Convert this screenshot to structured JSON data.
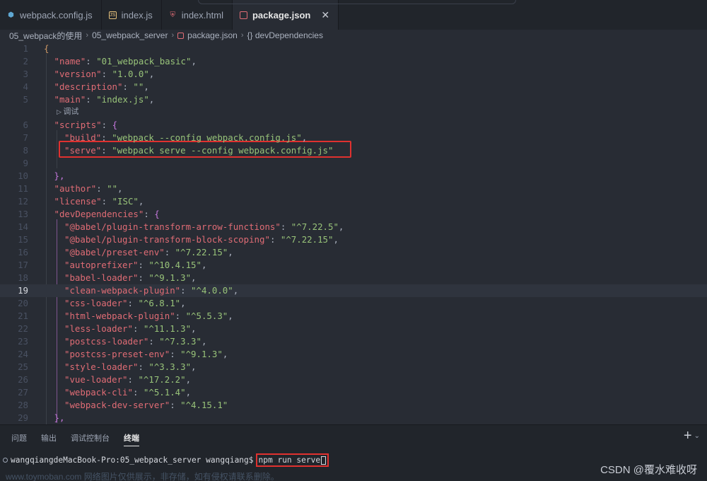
{
  "tabs": [
    {
      "label": "webpack.config.js",
      "icon": "webpack-icon",
      "color": "#5fa8d3"
    },
    {
      "label": "index.js",
      "icon": "js-icon",
      "color": "#e5c07b"
    },
    {
      "label": "index.html",
      "icon": "html-icon",
      "color": "#e06c75"
    },
    {
      "label": "package.json",
      "icon": "json-icon",
      "color": "#e06c75",
      "active": true
    }
  ],
  "breadcrumb": {
    "items": [
      "05_webpack的使用",
      "05_webpack_server",
      "package.json",
      "{} devDependencies"
    ]
  },
  "editor": {
    "code_lens": "调试",
    "current_line": 19,
    "lines": [
      {
        "n": "1",
        "t": "{"
      },
      {
        "n": "2",
        "k": "\"name\"",
        "v": "\"01_webpack_basic\"",
        "e": ","
      },
      {
        "n": "3",
        "k": "\"version\"",
        "v": "\"1.0.0\"",
        "e": ","
      },
      {
        "n": "4",
        "k": "\"description\"",
        "v": "\"\"",
        "e": ","
      },
      {
        "n": "5",
        "k": "\"main\"",
        "v": "\"index.js\"",
        "e": ","
      },
      {
        "n": "6",
        "k": "\"scripts\"",
        "v": "{",
        "e": ""
      },
      {
        "n": "7",
        "k": "\"build\"",
        "v": "\"webpack --config webpack.config.js\"",
        "e": ","
      },
      {
        "n": "8",
        "k": "\"serve\"",
        "v": "\"webpack serve --config webpack.config.js\"",
        "e": ""
      },
      {
        "n": "9",
        "t": ""
      },
      {
        "n": "10",
        "t": "},"
      },
      {
        "n": "11",
        "k": "\"author\"",
        "v": "\"\"",
        "e": ","
      },
      {
        "n": "12",
        "k": "\"license\"",
        "v": "\"ISC\"",
        "e": ","
      },
      {
        "n": "13",
        "k": "\"devDependencies\"",
        "v": "{",
        "e": ""
      },
      {
        "n": "14",
        "k": "\"@babel/plugin-transform-arrow-functions\"",
        "v": "\"^7.22.5\"",
        "e": ","
      },
      {
        "n": "15",
        "k": "\"@babel/plugin-transform-block-scoping\"",
        "v": "\"^7.22.15\"",
        "e": ","
      },
      {
        "n": "16",
        "k": "\"@babel/preset-env\"",
        "v": "\"^7.22.15\"",
        "e": ","
      },
      {
        "n": "17",
        "k": "\"autoprefixer\"",
        "v": "\"^10.4.15\"",
        "e": ","
      },
      {
        "n": "18",
        "k": "\"babel-loader\"",
        "v": "\"^9.1.3\"",
        "e": ","
      },
      {
        "n": "19",
        "k": "\"clean-webpack-plugin\"",
        "v": "\"^4.0.0\"",
        "e": ","
      },
      {
        "n": "20",
        "k": "\"css-loader\"",
        "v": "\"^6.8.1\"",
        "e": ","
      },
      {
        "n": "21",
        "k": "\"html-webpack-plugin\"",
        "v": "\"^5.5.3\"",
        "e": ","
      },
      {
        "n": "22",
        "k": "\"less-loader\"",
        "v": "\"^11.1.3\"",
        "e": ","
      },
      {
        "n": "23",
        "k": "\"postcss-loader\"",
        "v": "\"^7.3.3\"",
        "e": ","
      },
      {
        "n": "24",
        "k": "\"postcss-preset-env\"",
        "v": "\"^9.1.3\"",
        "e": ","
      },
      {
        "n": "25",
        "k": "\"style-loader\"",
        "v": "\"^3.3.3\"",
        "e": ","
      },
      {
        "n": "26",
        "k": "\"vue-loader\"",
        "v": "\"^17.2.2\"",
        "e": ","
      },
      {
        "n": "27",
        "k": "\"webpack-cli\"",
        "v": "\"^5.1.4\"",
        "e": ","
      },
      {
        "n": "28",
        "k": "\"webpack-dev-server\"",
        "v": "\"^4.15.1\"",
        "e": ""
      },
      {
        "n": "29",
        "t": "},"
      }
    ]
  },
  "panel": {
    "tabs": [
      "问题",
      "输出",
      "调试控制台",
      "终端"
    ],
    "active_tab": "终端",
    "add_icon": "+",
    "terminal_prompt": "wangqiangdeMacBook-Pro:05_webpack_server wangqiang$",
    "terminal_command": "npm run serve",
    "watermark": "www.toymoban.com 网络图片仅供展示，非存储，如有侵权请联系删除。",
    "credit": "CSDN @覆水难收呀"
  },
  "colors": {
    "highlight_box": "#e0312f",
    "key": "#e06c75",
    "string": "#98c379"
  }
}
